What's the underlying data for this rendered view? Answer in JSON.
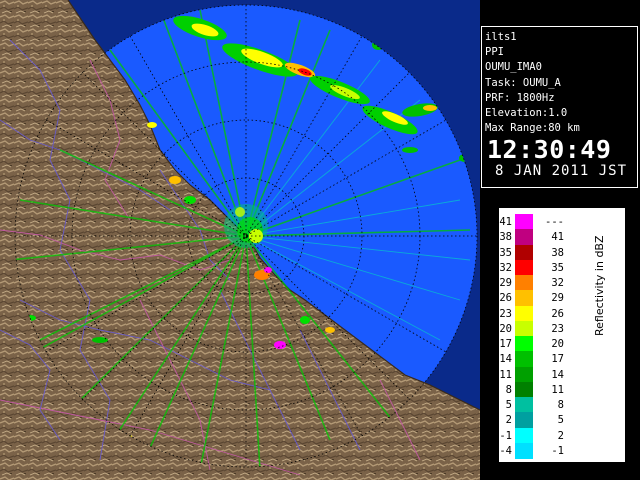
{
  "info": {
    "station": "ilts1",
    "product": "PPI",
    "site": "OUMU_IMA0",
    "task": "Task: OUMU_A",
    "prf": "PRF: 1800Hz",
    "elevation": "Elevation:1.0",
    "max_range": "Max Range:80 km",
    "time": "12:30:49",
    "date": "8 JAN 2011 JST"
  },
  "legend": {
    "unit_label": "Reflectivity in dBZ",
    "left_labels": [
      ">41",
      "38",
      "35",
      "32",
      "29",
      "26",
      "23",
      "20",
      "17",
      "14",
      "11",
      "8",
      "5",
      "2",
      "-1",
      "-4"
    ],
    "right_labels": [
      "---",
      "41",
      "38",
      "35",
      "32",
      "29",
      "26",
      "23",
      "20",
      "17",
      "14",
      "11",
      "8",
      "5",
      "2",
      "-1"
    ],
    "colors": [
      "#ff00ff",
      "#c00080",
      "#b00000",
      "#ff0000",
      "#ff8000",
      "#ffc000",
      "#ffff00",
      "#c8ff00",
      "#00ff00",
      "#00c000",
      "#00a000",
      "#008000",
      "#00c0a0",
      "#00a0a0",
      "#00ffff",
      "#00e0ff"
    ]
  },
  "map": {
    "sea_color": "#1a5aff",
    "outside_color": "#0a2a8a",
    "land_color": "#8a7256"
  }
}
